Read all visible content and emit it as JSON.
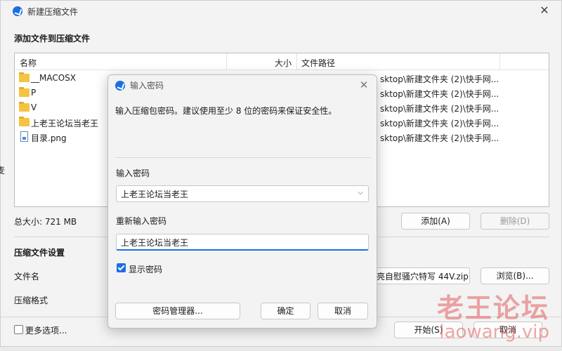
{
  "window": {
    "title": "新建压缩文件"
  },
  "section_add": {
    "title": "添加文件到压缩文件"
  },
  "file_list": {
    "columns": [
      "名称",
      "大小",
      "文件路径"
    ],
    "rows": [
      {
        "name": "__MACOSX",
        "type": "folder",
        "path": "sktop\\新建文件夹 (2)\\快手网..."
      },
      {
        "name": "P",
        "type": "folder",
        "path": "sktop\\新建文件夹 (2)\\快手网..."
      },
      {
        "name": "V",
        "type": "folder",
        "path": "sktop\\新建文件夹 (2)\\快手网..."
      },
      {
        "name": "上老王论坛当老王",
        "type": "folder",
        "path": "sktop\\新建文件夹 (2)\\快手网..."
      },
      {
        "name": "目录.png",
        "type": "png",
        "path": "sktop\\新建文件夹 (2)\\快手网..."
      }
    ]
  },
  "partial_left": "麦",
  "total_size": "总大小: 721 MB",
  "add_button": "添加(A)",
  "delete_button": "删除(D)",
  "settings": {
    "title": "压缩文件设置",
    "filename_label": "文件名",
    "filename_value": "亮自慰骚穴特写 44V.zip",
    "browse_button": "浏览(B)...",
    "format_label": "压缩格式"
  },
  "more_options": "更多选项...",
  "start_button": "开始(S)",
  "cancel_button": "取消",
  "dialog": {
    "title": "输入密码",
    "description": "输入压缩包密码。建议使用至少 8 位的密码来保证安全性。",
    "password_label": "输入密码",
    "password_value": "上老王论坛当老王",
    "confirm_label": "重新输入密码",
    "confirm_value": "上老王论坛当老王",
    "show_password": "显示密码",
    "manager_button": "密码管理器...",
    "ok_button": "确定",
    "cancel_button": "取消"
  },
  "watermark": {
    "line1": "老王论坛",
    "line2": "laowang.vip"
  },
  "colors": {
    "accent": "#1d6fe0",
    "folder": "#f5c342",
    "watermark": "#e25c5c"
  }
}
